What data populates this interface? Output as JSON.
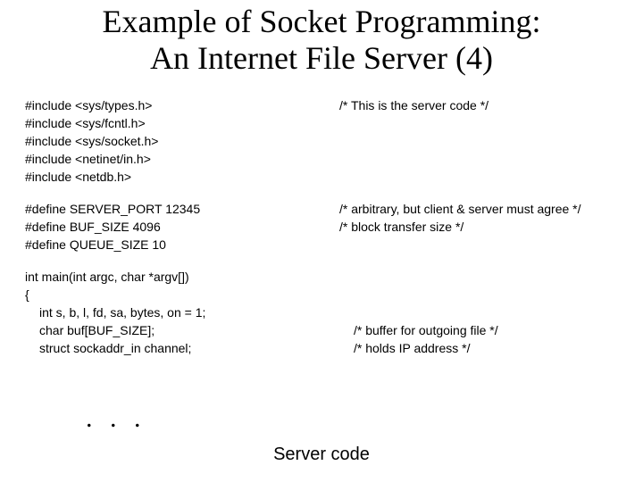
{
  "title_line1": "Example of Socket Programming:",
  "title_line2": "An Internet File Server (4)",
  "code": {
    "l0_left": "#include <sys/types.h>",
    "l0_right": "/* This is the server code */",
    "l1_left": "#include <sys/fcntl.h>",
    "l2_left": "#include <sys/socket.h>",
    "l3_left": "#include <netinet/in.h>",
    "l4_left": "#include <netdb.h>",
    "l5_left": "#define SERVER_PORT 12345",
    "l5_right": "/* arbitrary, but client & server must agree */",
    "l6_left": "#define BUF_SIZE 4096",
    "l6_right": "/* block transfer size */",
    "l7_left": "#define QUEUE_SIZE 10",
    "l8_left": "int main(int argc, char *argv[])",
    "l9_left": "{",
    "l10_left": "int s, b, l, fd, sa, bytes, on = 1;",
    "l11_left": "char buf[BUF_SIZE];",
    "l11_right": "/* buffer for outgoing file */",
    "l12_left": "struct sockaddr_in channel;",
    "l12_right": "/* holds IP address */"
  },
  "ellipsis": ". . .",
  "caption": "Server code"
}
